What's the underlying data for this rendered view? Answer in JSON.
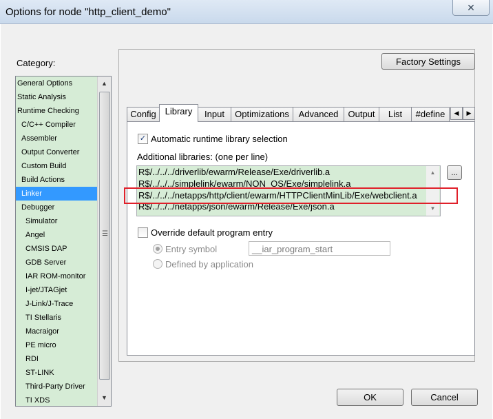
{
  "window": {
    "title": "Options for node \"http_client_demo\"",
    "close_glyph": "✕"
  },
  "category": {
    "label": "Category:",
    "items": [
      {
        "label": "General Options",
        "indent": false
      },
      {
        "label": "Static Analysis",
        "indent": false
      },
      {
        "label": "Runtime Checking",
        "indent": false
      },
      {
        "label": "C/C++ Compiler",
        "indent": true
      },
      {
        "label": "Assembler",
        "indent": true
      },
      {
        "label": "Output Converter",
        "indent": true
      },
      {
        "label": "Custom Build",
        "indent": true
      },
      {
        "label": "Build Actions",
        "indent": true
      },
      {
        "label": "Linker",
        "indent": true,
        "selected": true
      },
      {
        "label": "Debugger",
        "indent": true
      },
      {
        "label": "Simulator",
        "indent": true,
        "sub": true
      },
      {
        "label": "Angel",
        "indent": true,
        "sub": true
      },
      {
        "label": "CMSIS DAP",
        "indent": true,
        "sub": true
      },
      {
        "label": "GDB Server",
        "indent": true,
        "sub": true
      },
      {
        "label": "IAR ROM-monitor",
        "indent": true,
        "sub": true
      },
      {
        "label": "I-jet/JTAGjet",
        "indent": true,
        "sub": true
      },
      {
        "label": "J-Link/J-Trace",
        "indent": true,
        "sub": true
      },
      {
        "label": "TI Stellaris",
        "indent": true,
        "sub": true
      },
      {
        "label": "Macraigor",
        "indent": true,
        "sub": true
      },
      {
        "label": "PE micro",
        "indent": true,
        "sub": true
      },
      {
        "label": "RDI",
        "indent": true,
        "sub": true
      },
      {
        "label": "ST-LINK",
        "indent": true,
        "sub": true
      },
      {
        "label": "Third-Party Driver",
        "indent": true,
        "sub": true
      },
      {
        "label": "TI XDS",
        "indent": true,
        "sub": true
      }
    ]
  },
  "factory_settings_label": "Factory Settings",
  "tabs": [
    {
      "label": "Config"
    },
    {
      "label": "Library",
      "active": true
    },
    {
      "label": "Input"
    },
    {
      "label": "Optimizations"
    },
    {
      "label": "Advanced"
    },
    {
      "label": "Output"
    },
    {
      "label": "List"
    },
    {
      "label": "#define"
    }
  ],
  "library": {
    "auto_lib_label": "Automatic runtime library selection",
    "auto_lib_checked": true,
    "additional_label": "Additional libraries: (one per line)",
    "lines": [
      "R$/../../../driverlib/ewarm/Release/Exe/driverlib.a",
      "R$/../../../simplelink/ewarm/NON_OS/Exe/simplelink.a",
      "R$/../../../netapps/http/client/ewarm/HTTPClientMinLib/Exe/webclient.a",
      "R$/../../../netapps/json/ewarm/Release/Exe/json.a"
    ],
    "browse_label": "...",
    "override_label": "Override default program entry",
    "override_checked": false,
    "entry_symbol_label": "Entry symbol",
    "entry_symbol_value": "__iar_program_start",
    "defined_by_app_label": "Defined by application"
  },
  "buttons": {
    "ok": "OK",
    "cancel": "Cancel"
  },
  "icons": {
    "check": "✓",
    "scroll_up": "▲",
    "scroll_down": "▼",
    "tab_left": "◀",
    "tab_right": "▶",
    "grip": "☰"
  }
}
